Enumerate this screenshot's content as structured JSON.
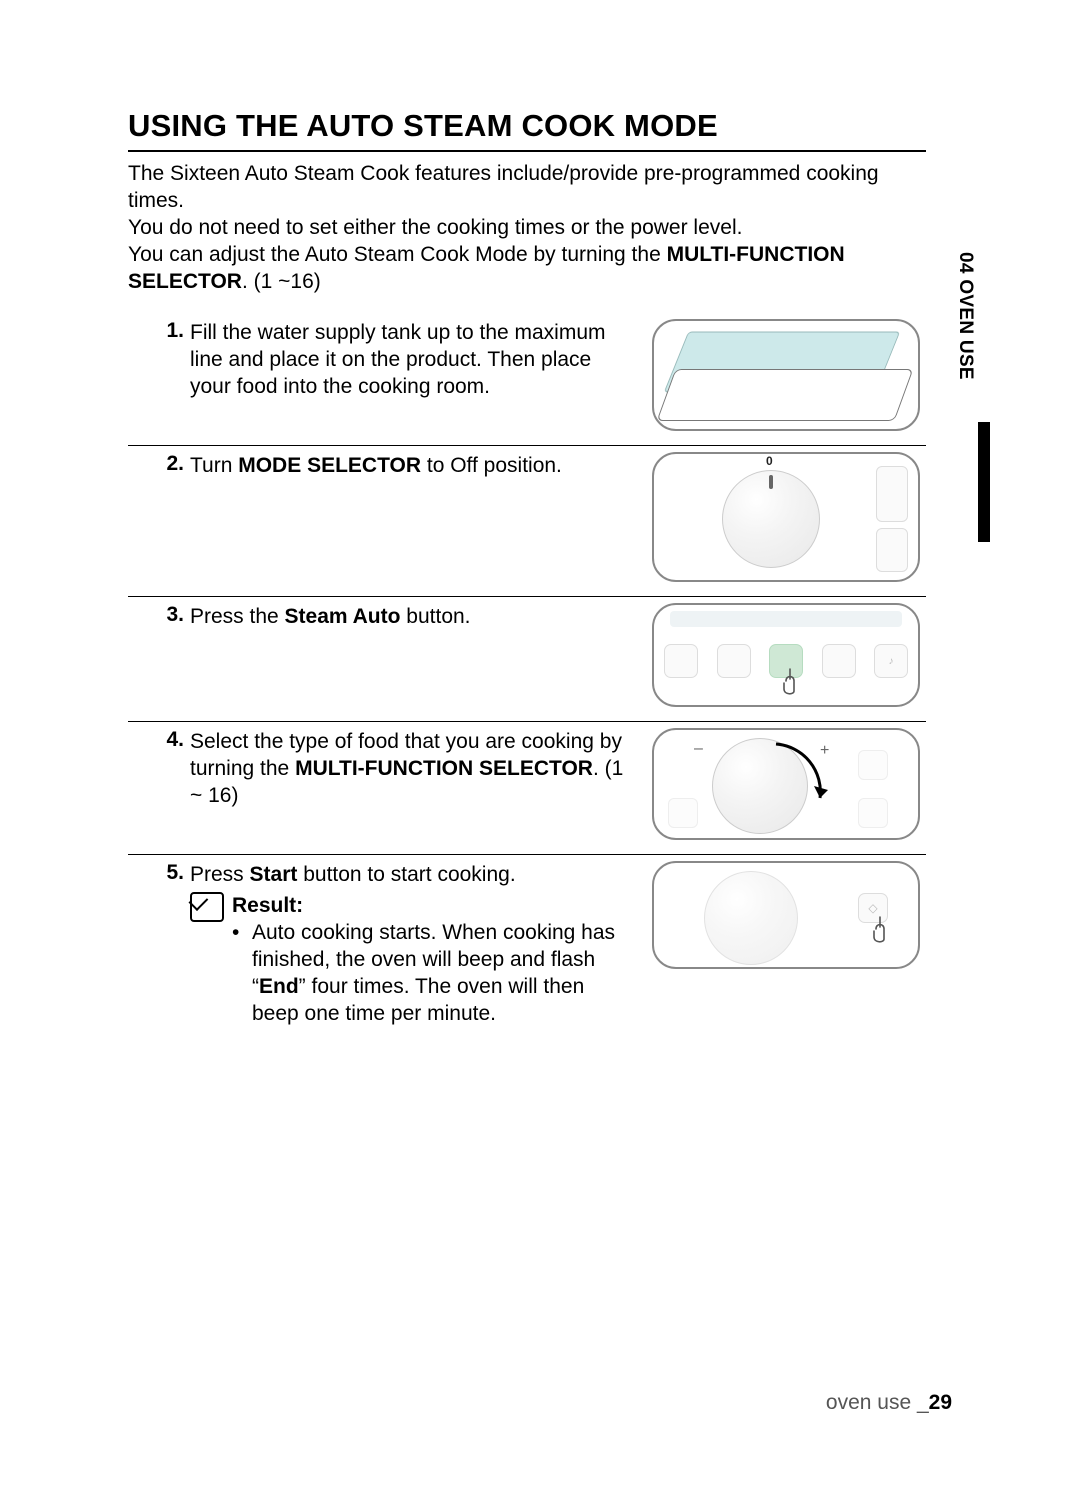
{
  "title": "USING THE AUTO STEAM COOK MODE",
  "intro": {
    "line1": "The Sixteen Auto Steam Cook features include/provide pre-programmed cooking times.",
    "line2": "You do not need to set either the cooking times or the power level.",
    "line3_a": "You can adjust the Auto Steam Cook Mode by turning the ",
    "line3_b_bold": "MULTI-FUNCTION SELECTOR",
    "line3_c": ". (1 ~16)"
  },
  "side_tab": "04 OVEN USE",
  "steps": [
    {
      "num": "1.",
      "text": "Fill the water supply tank up to the maximum line and place it on the product. Then place your food into the cooking room."
    },
    {
      "num": "2.",
      "text_pre": "Turn ",
      "text_bold": "MODE SELECTOR",
      "text_post": " to Off position.",
      "dial_zero": "0"
    },
    {
      "num": "3.",
      "text_pre": "Press the ",
      "text_bold": "Steam Auto",
      "text_post": " button."
    },
    {
      "num": "4.",
      "text_pre": "Select the type of food that you are cooking by turning the ",
      "text_bold": "MULTI-FUNCTION SELECTOR",
      "text_post": ". (1 ~ 16)"
    },
    {
      "num": "5.",
      "text_pre": "Press ",
      "text_bold": "Start",
      "text_post": " button to start cooking.",
      "result_label": "Result:",
      "result_bullet_a": "Auto cooking starts. When cooking has finished, the oven will beep and flash “",
      "result_bullet_bold": "End",
      "result_bullet_b": "” four times. The oven will then beep one time per minute."
    }
  ],
  "footer": {
    "section": "oven use _",
    "page": "29"
  },
  "marks": {
    "minus": "–",
    "plus": "+",
    "bell": "♪",
    "diamond": "◇"
  }
}
